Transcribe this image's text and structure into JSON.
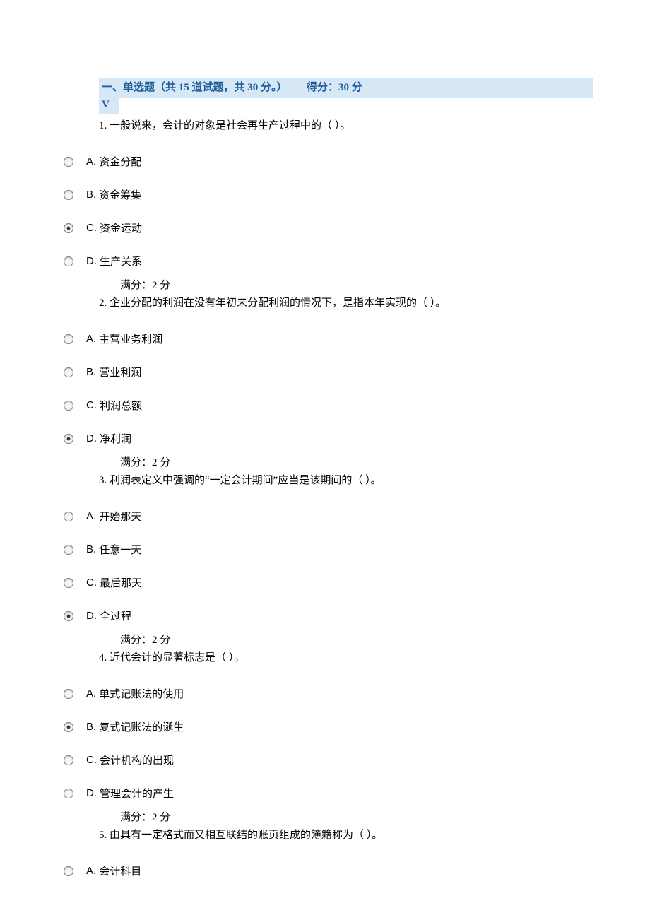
{
  "header": {
    "section_title": "一、单选题（共 15 道试题，共 30 分。）",
    "score_label": "得分：30 分",
    "v": "V"
  },
  "questions": [
    {
      "num": "1.",
      "text": "一般说来，会计的对象是社会再生产过程中的（ ）。",
      "options": [
        {
          "letter": "A.",
          "text": "资金分配",
          "selected": false
        },
        {
          "letter": "B.",
          "text": "资金筹集",
          "selected": false
        },
        {
          "letter": "C.",
          "text": "资金运动",
          "selected": true
        },
        {
          "letter": "D.",
          "text": "生产关系",
          "selected": false
        }
      ],
      "full_score": "满分：2 分"
    },
    {
      "num": "2.",
      "text": "企业分配的利润在没有年初未分配利润的情况下，是指本年实现的（ ）。",
      "options": [
        {
          "letter": "A.",
          "text": "主营业务利润",
          "selected": false
        },
        {
          "letter": "B.",
          "text": "营业利润",
          "selected": false
        },
        {
          "letter": "C.",
          "text": "利润总额",
          "selected": false
        },
        {
          "letter": "D.",
          "text": "净利润",
          "selected": true
        }
      ],
      "full_score": "满分：2 分"
    },
    {
      "num": "3.",
      "text": "利润表定义中强调的“一定会计期间”应当是该期间的（ ）。",
      "options": [
        {
          "letter": "A.",
          "text": "开始那天",
          "selected": false
        },
        {
          "letter": "B.",
          "text": "任意一天",
          "selected": false
        },
        {
          "letter": "C.",
          "text": "最后那天",
          "selected": false
        },
        {
          "letter": "D.",
          "text": "全过程",
          "selected": true
        }
      ],
      "full_score": "满分：2 分"
    },
    {
      "num": "4.",
      "text": "近代会计的显著标志是（ ）。",
      "options": [
        {
          "letter": "A.",
          "text": "单式记账法的使用",
          "selected": false
        },
        {
          "letter": "B.",
          "text": "复式记账法的诞生",
          "selected": true
        },
        {
          "letter": "C.",
          "text": "会计机构的出现",
          "selected": false
        },
        {
          "letter": "D.",
          "text": "管理会计的产生",
          "selected": false
        }
      ],
      "full_score": "满分：2 分"
    },
    {
      "num": "5.",
      "text": "由具有一定格式而又相互联结的账页组成的簿籍称为（ ）。",
      "options": [
        {
          "letter": "A.",
          "text": "会计科目",
          "selected": false
        }
      ],
      "full_score": ""
    }
  ]
}
